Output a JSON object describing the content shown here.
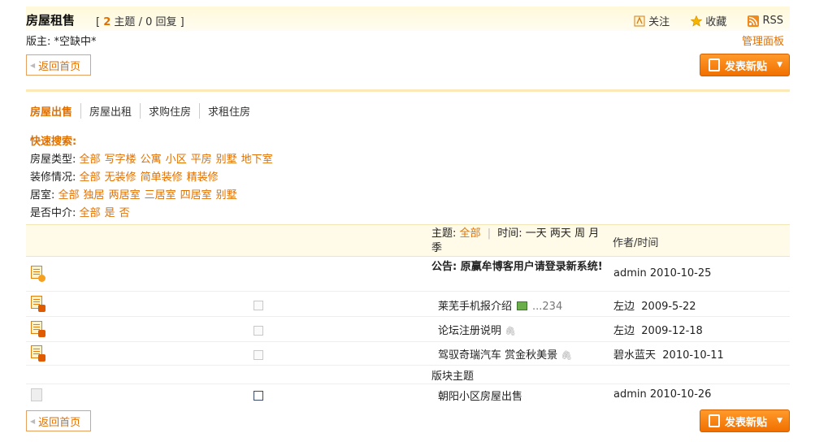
{
  "header": {
    "forum_title": "房屋租售",
    "counts_open": "[",
    "topics_num": "2",
    "topics_label": "主题",
    "replies": "/ 0 回复",
    "counts_close": "]",
    "follow": "关注",
    "favorite": "收藏",
    "rss": "RSS",
    "moderator_label": "版主:",
    "moderator_value": "*空缺中*",
    "admin_panel": "管理面板"
  },
  "nav": {
    "back_home": "返回首页",
    "post_new": "发表新贴"
  },
  "tabs": [
    "房屋出售",
    "房屋出租",
    "求购住房",
    "求租住房"
  ],
  "quick_search": {
    "title": "快速搜索:",
    "rows": [
      {
        "label": "房屋类型:",
        "options": [
          "全部",
          "写字楼",
          "公寓",
          "小区",
          "平房",
          "别墅",
          "地下室"
        ]
      },
      {
        "label": "装修情况:",
        "options": [
          "全部",
          "无装修",
          "简单装修",
          "精装修"
        ]
      },
      {
        "label": "居室:",
        "options": [
          "全部",
          "独居",
          "两居室",
          "三居室",
          "四居室",
          "别墅"
        ]
      },
      {
        "label": "是否中介:",
        "options": [
          "全部",
          "是",
          "否"
        ]
      }
    ]
  },
  "table": {
    "filter_subject": "主题:",
    "filter_all": "全部",
    "filter_time": "时间:",
    "time_options": [
      "一天",
      "两天",
      "周",
      "月",
      "季"
    ],
    "author_header": "作者/时间",
    "announcement": {
      "text": "公告: 原赢牟博客用户请登录新系统!",
      "author": "admin 2010-10-25"
    },
    "rows": [
      {
        "subject": "莱芜手机报介绍",
        "pages": "...234",
        "author": "左边",
        "date": "2009-5-22",
        "attach": false,
        "has_pic": true
      },
      {
        "subject": "论坛注册说明",
        "pages": "",
        "author": "左边",
        "date": "2009-12-18",
        "attach": true,
        "has_pic": false
      },
      {
        "subject": "驾驭奇瑞汽车  赏金秋美景",
        "pages": "",
        "author": "碧水蓝天",
        "date": "2010-10-11",
        "attach": true,
        "has_pic": false
      }
    ],
    "section_title": "版块主题",
    "section_rows": [
      {
        "subject": "朝阳小区房屋出售",
        "author": "admin",
        "date": "2010-10-26"
      }
    ]
  },
  "colors": {
    "accent": "#e07000",
    "header_bg": "#fff8d9",
    "button": "#f07000"
  }
}
